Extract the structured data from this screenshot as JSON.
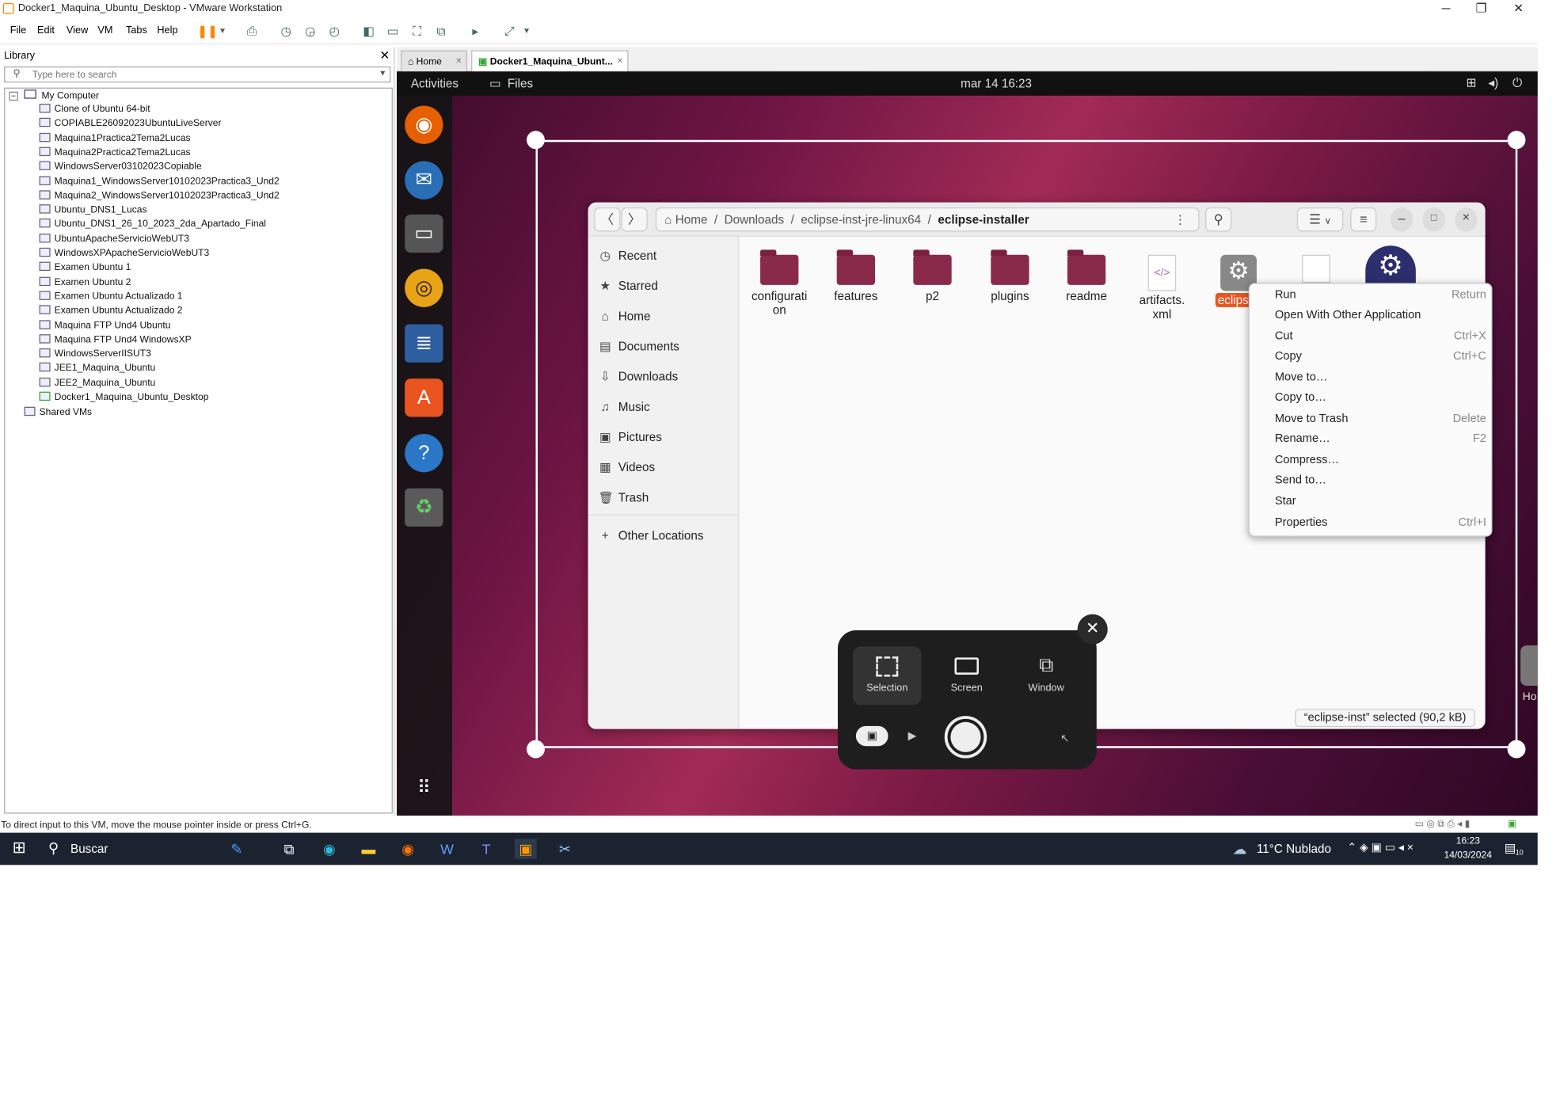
{
  "window": {
    "title": "Docker1_Maquina_Ubuntu_Desktop - VMware Workstation",
    "minimize": "─",
    "maximize": "❐",
    "close": "✕"
  },
  "menu": [
    "File",
    "Edit",
    "View",
    "VM",
    "Tabs",
    "Help"
  ],
  "library": {
    "title": "Library",
    "close": "✕",
    "search_placeholder": "Type here to search",
    "root": "My Computer",
    "vms": [
      "Clone of Ubuntu 64-bit",
      "COPIABLE26092023UbuntuLiveServer",
      "Maquina1Practica2Tema2Lucas",
      "Maquina2Practica2Tema2Lucas",
      "WindowsServer03102023Copiable",
      "Maquina1_WindowsServer10102023Practica3_Und2",
      "Maquina2_WindowsServer10102023Practica3_Und2",
      "Ubuntu_DNS1_Lucas",
      "Ubuntu_DNS1_26_10_2023_2da_Apartado_Final",
      "UbuntuApacheServicioWebUT3",
      "WindowsXPApacheServicioWebUT3",
      "Examen Ubuntu 1",
      "Examen Ubuntu 2",
      "Examen Ubuntu Actualizado 1",
      "Examen Ubuntu Actualizado 2",
      "Maquina FTP Und4 Ubuntu",
      "Maquina FTP Und4 WindowsXP",
      "WindowsServerIISUT3",
      "JEE1_Maquina_Ubuntu",
      "JEE2_Maquina_Ubuntu",
      "Docker1_Maquina_Ubuntu_Desktop"
    ],
    "shared": "Shared VMs"
  },
  "tabs": {
    "home": "Home",
    "vm": "Docker1_Maquina_Ubunt...",
    "close": "✕"
  },
  "ubuntu": {
    "activities": "Activities",
    "app_name": "Files",
    "clock": "mar 14  16:23"
  },
  "files": {
    "path": [
      "Home",
      "Downloads",
      "eclipse-inst-jre-linux64",
      "eclipse-installer"
    ],
    "sidebar": [
      "Recent",
      "Starred",
      "Home",
      "Documents",
      "Downloads",
      "Music",
      "Pictures",
      "Videos",
      "Trash",
      "Other Locations"
    ],
    "items": [
      {
        "line1": "configurati",
        "line2": "on"
      },
      {
        "line1": "features",
        "line2": ""
      },
      {
        "line1": "p2",
        "line2": ""
      },
      {
        "line1": "plugins",
        "line2": ""
      },
      {
        "line1": "readme",
        "line2": ""
      },
      {
        "line1": "artifacts.",
        "line2": "xml"
      },
      {
        "line1": "eclipse-",
        "line2": ""
      }
    ],
    "status": "“eclipse-inst” selected  (90,2 kB)"
  },
  "context_menu": [
    {
      "label": "Run",
      "shortcut": "Return"
    },
    {
      "label": "Open With Other Application",
      "shortcut": ""
    },
    {
      "label": "Cut",
      "shortcut": "Ctrl+X"
    },
    {
      "label": "Copy",
      "shortcut": "Ctrl+C"
    },
    {
      "label": "Move to…",
      "shortcut": ""
    },
    {
      "label": "Copy to…",
      "shortcut": ""
    },
    {
      "label": "Move to Trash",
      "shortcut": "Delete"
    },
    {
      "label": "Rename…",
      "shortcut": "F2"
    },
    {
      "label": "Compress…",
      "shortcut": ""
    },
    {
      "label": "Send to…",
      "shortcut": ""
    },
    {
      "label": "Star",
      "shortcut": ""
    },
    {
      "label": "Properties",
      "shortcut": "Ctrl+I"
    }
  ],
  "screenshot_tool": {
    "selection": "Selection",
    "screen": "Screen",
    "window": "Window",
    "close": "✕"
  },
  "vm_partial_label": "Ho",
  "statusbar": "To direct input to this VM, move the mouse pointer inside or press Ctrl+G.",
  "taskbar": {
    "search": "Buscar",
    "weather": "11°C  Nublado",
    "time": "16:23",
    "date": "14/03/2024",
    "notif_count": "10"
  },
  "colors": {
    "ubuntu_accent": "#e95420",
    "folder": "#8a2a4a",
    "taskbar": "#1b2330"
  }
}
